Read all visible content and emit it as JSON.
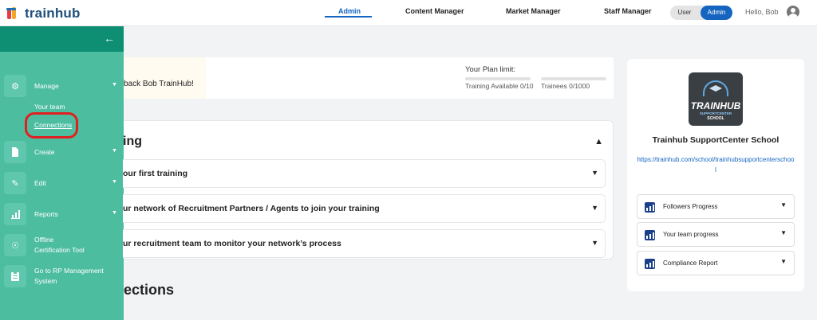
{
  "app": {
    "logo_text": "trainhub"
  },
  "topnav": {
    "items": [
      "Admin",
      "Content Manager",
      "Market Manager",
      "Staff Manager"
    ],
    "active": "Admin"
  },
  "role_toggle": {
    "user_label": "User",
    "admin_label": "Admin",
    "selected": "Admin"
  },
  "greeting": "Hello, Bob",
  "sidebar": {
    "items": [
      {
        "label": "Manage",
        "icon": "gear-icon",
        "has_chevron": true
      },
      {
        "label": "Create",
        "icon": "document-icon",
        "has_chevron": true
      },
      {
        "label": "Edit",
        "icon": "pencil-icon",
        "has_chevron": true
      },
      {
        "label": "Reports",
        "icon": "chart-icon",
        "has_chevron": true
      },
      {
        "label_line1": "Offline",
        "label_line2": "Certification Tool",
        "icon": "certificate-icon"
      },
      {
        "label_line1": "Go to RP Management",
        "label_line2": "System",
        "icon": "clipboard-icon"
      }
    ],
    "manage_subitems": [
      "Your team",
      "Connections"
    ],
    "highlighted_subitem": "Connections"
  },
  "welcome": {
    "text": "back Bob TrainHub!",
    "plan_title": "Your Plan limit:",
    "training_available": "Training Available 0/10",
    "trainees": "Trainees 0/1000"
  },
  "training_section": {
    "title": "ing",
    "steps": [
      "our first training",
      "ur network of Recruitment Partners / Agents to join your training",
      "ur recruitment team to monitor your network’s process"
    ]
  },
  "connections_heading": "ections",
  "school": {
    "logo_title": "TRAINHUB",
    "logo_sub1": "SUPPORTCENTER",
    "logo_sub2": "SCHOOL",
    "name": "Trainhub SupportCenter School",
    "url": "https://trainhub.com/school/trainhubsupportcenterschool",
    "reports": [
      "Followers Progress",
      "Your team progress",
      "Compliance Report"
    ]
  },
  "colors": {
    "sidebar_bg": "#4dbda0",
    "sidebar_header": "#0e8f73",
    "accent_blue": "#1565c0",
    "highlight_red": "#e02020"
  }
}
